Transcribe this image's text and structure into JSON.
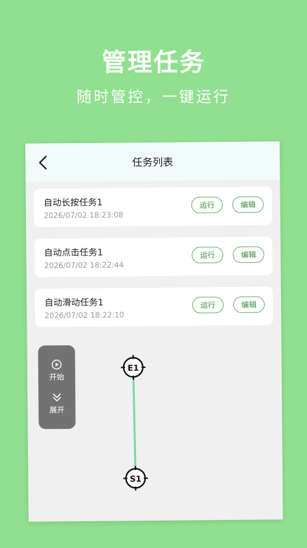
{
  "promo": {
    "headline": "管理任务",
    "subline": "随时管控，一键运行"
  },
  "screen": {
    "title": "任务列表",
    "back_icon": "chevron-left-icon"
  },
  "tasks": [
    {
      "name": "自动长按任务1",
      "time": "2026/07/02 18:23:08",
      "run_label": "运行",
      "edit_label": "编辑"
    },
    {
      "name": "自动点击任务1",
      "time": "2026/07/02 18:22:44",
      "run_label": "运行",
      "edit_label": "编辑"
    },
    {
      "name": "自动滑动任务1",
      "time": "2026/07/02 18:22:10",
      "run_label": "运行",
      "edit_label": "编辑"
    }
  ],
  "floating_panel": {
    "start_label": "开始",
    "start_icon": "play-circle-icon",
    "expand_label": "展开",
    "expand_icon": "double-chevron-down-icon"
  },
  "swipe_path": {
    "end_marker": "E1",
    "start_marker": "S1",
    "line_color": "#7fd7a0"
  },
  "colors": {
    "background": "#90e090",
    "button_border": "#66b266",
    "panel": "#727272"
  }
}
